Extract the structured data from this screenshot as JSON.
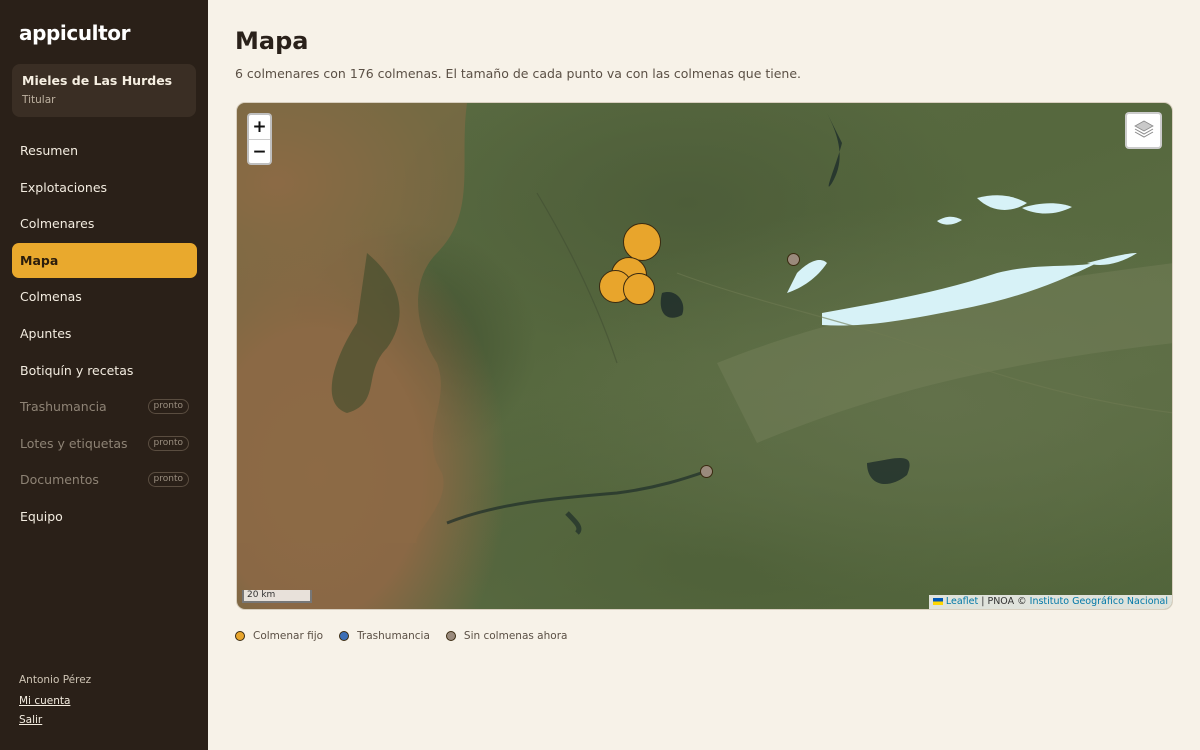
{
  "brand": "appicultor",
  "org": {
    "name": "Mieles de Las Hurdes",
    "role": "Titular"
  },
  "nav": [
    {
      "label": "Resumen",
      "state": "normal"
    },
    {
      "label": "Explotaciones",
      "state": "normal"
    },
    {
      "label": "Colmenares",
      "state": "normal"
    },
    {
      "label": "Mapa",
      "state": "active"
    },
    {
      "label": "Colmenas",
      "state": "normal"
    },
    {
      "label": "Apuntes",
      "state": "normal"
    },
    {
      "label": "Botiquín y recetas",
      "state": "normal"
    },
    {
      "label": "Trashumancia",
      "state": "disabled",
      "badge": "pronto"
    },
    {
      "label": "Lotes y etiquetas",
      "state": "disabled",
      "badge": "pronto"
    },
    {
      "label": "Documentos",
      "state": "disabled",
      "badge": "pronto"
    },
    {
      "label": "Equipo",
      "state": "normal"
    }
  ],
  "user": {
    "name": "Antonio Pérez",
    "account_link": "Mi cuenta",
    "logout_link": "Salir"
  },
  "page": {
    "title": "Mapa",
    "subtitle": "6 colmenares con 176 colmenas. El tamaño de cada punto va con las colmenas que tiene."
  },
  "map": {
    "zoom_in": "+",
    "zoom_out": "−",
    "scale_label": "20 km",
    "attribution": {
      "leaflet": "Leaflet",
      "source": " | PNOA © ",
      "provider": "Instituto Geográfico Nacional"
    },
    "layers_icon": "layers-icon"
  },
  "legend": [
    {
      "label": "Colmenar fijo",
      "color": "#e8a52c"
    },
    {
      "label": "Trashumancia",
      "color": "#3d6fb6"
    },
    {
      "label": "Sin colmenas ahora",
      "color": "#9a8a7c"
    }
  ],
  "colors": {
    "accent": "#e9a92d",
    "sidebar": "#2a2018",
    "background": "#f7f2e8"
  }
}
